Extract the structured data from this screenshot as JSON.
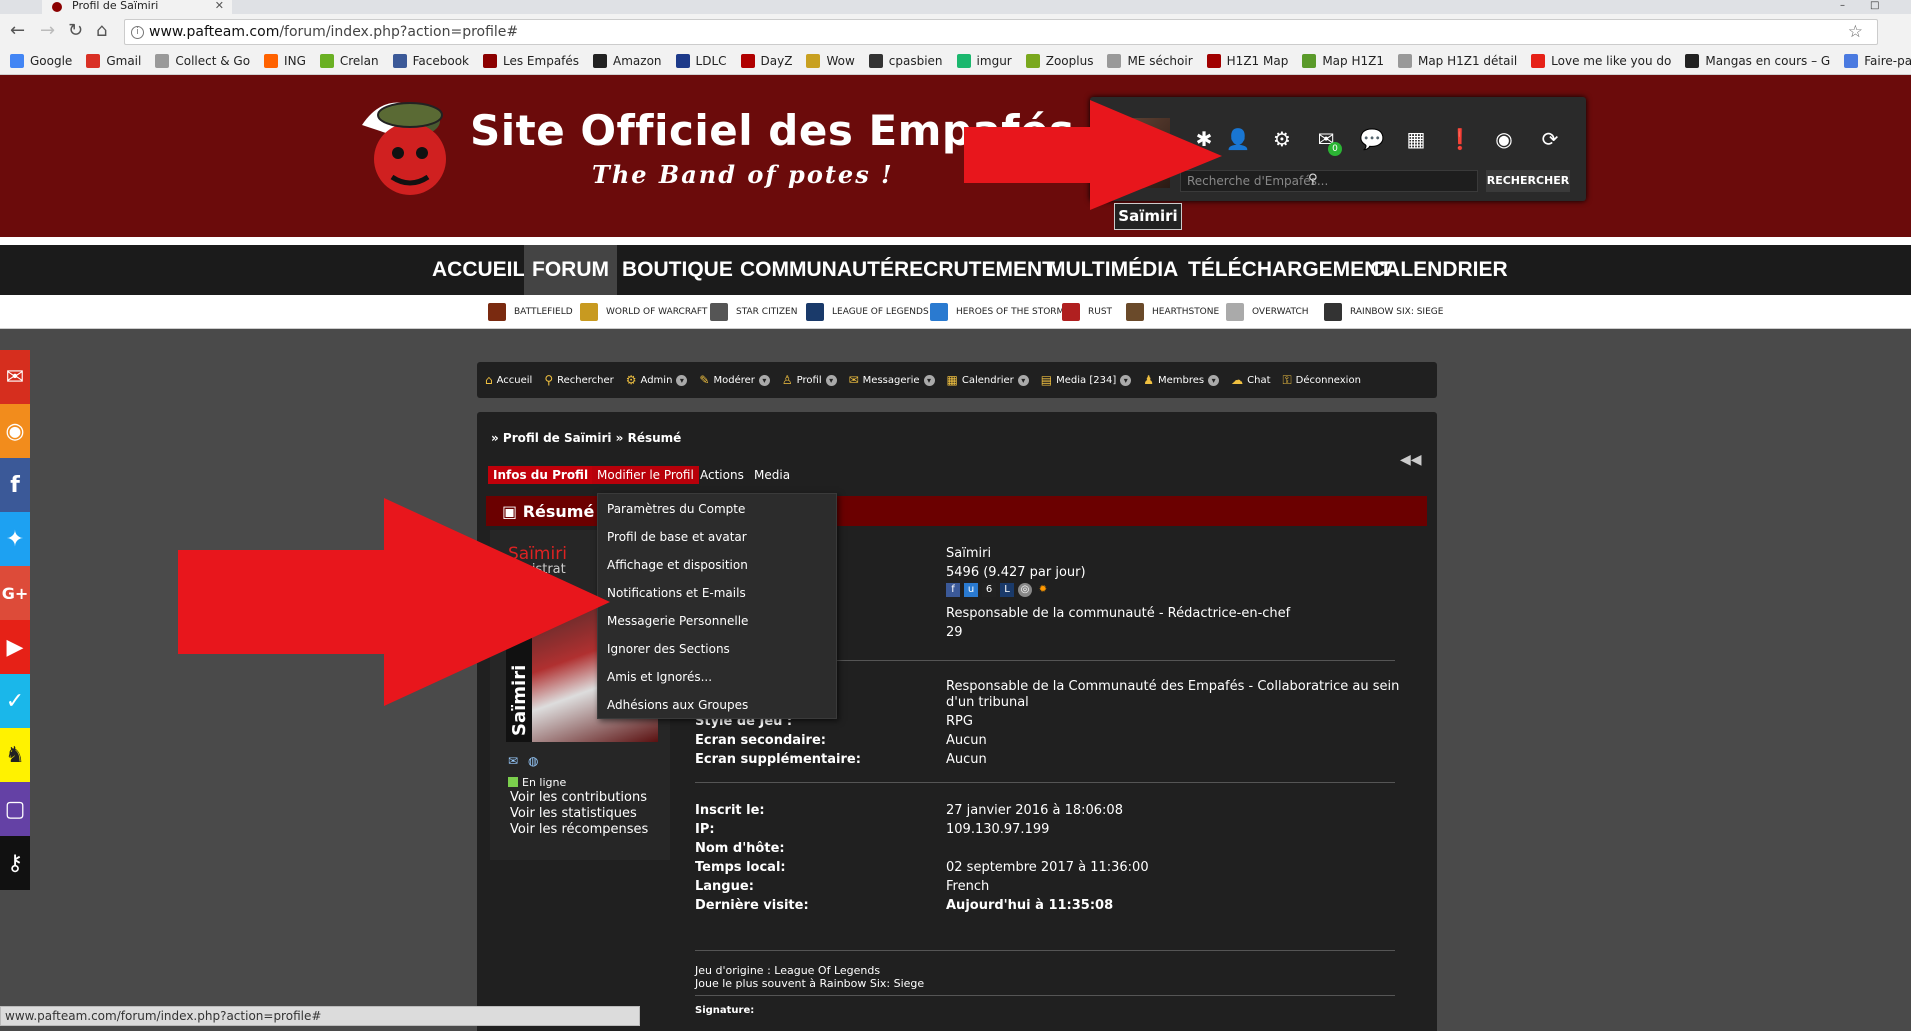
{
  "browser": {
    "tab_title": "Profil de Saïmiri",
    "url_host": "www.pafteam.com",
    "url_path": "/forum/index.php?action=profile#",
    "status_url": "www.pafteam.com/forum/index.php?action=profile#",
    "bookmarks": [
      {
        "label": "Google",
        "color": "#4285f4"
      },
      {
        "label": "Gmail",
        "color": "#d93025"
      },
      {
        "label": "Collect & Go",
        "color": "#999999"
      },
      {
        "label": "ING",
        "color": "#ff6200"
      },
      {
        "label": "Crelan",
        "color": "#6ab023"
      },
      {
        "label": "Facebook",
        "color": "#3b5998"
      },
      {
        "label": "Les Empafés",
        "color": "#8b0000"
      },
      {
        "label": "Amazon",
        "color": "#222222"
      },
      {
        "label": "LDLC",
        "color": "#1d3a8a"
      },
      {
        "label": "DayZ",
        "color": "#b00000"
      },
      {
        "label": "Wow",
        "color": "#c8a020"
      },
      {
        "label": "cpasbien",
        "color": "#333333"
      },
      {
        "label": "imgur",
        "color": "#1bb76e"
      },
      {
        "label": "Zooplus",
        "color": "#7aa81e"
      },
      {
        "label": "ME séchoir",
        "color": "#999999"
      },
      {
        "label": "H1Z1 Map",
        "color": "#a00000"
      },
      {
        "label": "Map H1Z1",
        "color": "#5a9a2a"
      },
      {
        "label": "Map H1Z1 détail",
        "color": "#999999"
      },
      {
        "label": "Love me like you do",
        "color": "#e62117"
      },
      {
        "label": "Mangas en cours – G",
        "color": "#222222"
      },
      {
        "label": "Faire-part Ben",
        "color": "#4a7ae0"
      }
    ]
  },
  "site": {
    "title": "Site Officiel des Empafés",
    "subtitle": "The Band of potes !",
    "search_placeholder": "Recherche d'Empafés...",
    "search_button": "RECHERCHER",
    "username": "Saïmiri",
    "message_badge": "0"
  },
  "main_nav": [
    {
      "label": "ACCUEIL"
    },
    {
      "label": "FORUM",
      "active": true
    },
    {
      "label": "BOUTIQUE"
    },
    {
      "label": "COMMUNAUTÉ"
    },
    {
      "label": "RECRUTEMENT"
    },
    {
      "label": "MULTIMÉDIA"
    },
    {
      "label": "TÉLÉCHARGEMENT"
    },
    {
      "label": "CALENDRIER"
    }
  ],
  "games": [
    {
      "label": "BATTLEFIELD",
      "color": "#7a2a10"
    },
    {
      "label": "WORLD OF WARCRAFT",
      "color": "#c89a20"
    },
    {
      "label": "STAR CITIZEN",
      "color": "#555555"
    },
    {
      "label": "LEAGUE OF LEGENDS",
      "color": "#1a3a6a"
    },
    {
      "label": "HEROES OF THE STORM",
      "color": "#2a7ad0"
    },
    {
      "label": "RUST",
      "color": "#b02020"
    },
    {
      "label": "HEARTHSTONE",
      "color": "#6a4a2a"
    },
    {
      "label": "OVERWATCH",
      "color": "#aaaaaa"
    },
    {
      "label": "RAINBOW SIX: SIEGE",
      "color": "#333333"
    }
  ],
  "social_colors": [
    "#d62e1e",
    "#f28c1c",
    "#3b5998",
    "#1da1f2",
    "#dd4b39",
    "#e62117",
    "#1ab7ea",
    "#fff200",
    "#6441a5",
    "#111111"
  ],
  "forum_nav": [
    {
      "label": "Accueil",
      "caret": false
    },
    {
      "label": "Rechercher",
      "caret": false
    },
    {
      "label": "Admin",
      "caret": true
    },
    {
      "label": "Modérer",
      "caret": true
    },
    {
      "label": "Profil",
      "caret": true
    },
    {
      "label": "Messagerie",
      "caret": true
    },
    {
      "label": "Calendrier",
      "caret": true
    },
    {
      "label": "Media [234]",
      "caret": true
    },
    {
      "label": "Membres",
      "caret": true
    },
    {
      "label": "Chat",
      "caret": false
    },
    {
      "label": "Déconnexion",
      "caret": false
    }
  ],
  "profile": {
    "breadcrumb": "» Profil de Saïmiri » Résumé",
    "tabs": [
      "Infos du Profil",
      "Modifier le Profil",
      "Actions",
      "Media"
    ],
    "summary_title": "Résumé",
    "name": "Saïmiri",
    "role": "inistrat",
    "avatar_text": "Saïmiri",
    "online": "En ligne",
    "side_links": [
      "Voir les contributions",
      "Voir les statistiques",
      "Voir les récompenses"
    ],
    "values_top": [
      "Saïmiri",
      "5496 (9.427 par jour)",
      "Responsable de la communauté - Rédactrice-en-chef",
      "29"
    ],
    "position_line1": "Responsable de la Communauté des Empafés - Collaboratrice au sein",
    "position_line2": "d'un tribunal",
    "style_label": "Style de Jeu :",
    "style_val": "RPG",
    "screen2_label": "Ecran secondaire:",
    "screen2_val": "Aucun",
    "screen3_label": "Ecran supplémentaire:",
    "screen3_val": "Aucun",
    "fields": [
      {
        "label": "Inscrit le:",
        "value": "27 janvier 2016 à 18:06:08"
      },
      {
        "label": "IP:",
        "value": "109.130.97.199"
      },
      {
        "label": "Nom d'hôte:",
        "value": ""
      },
      {
        "label": "Temps local:",
        "value": "02 septembre 2017 à 11:36:00"
      },
      {
        "label": "Langue:",
        "value": "French"
      },
      {
        "label": "Dernière visite:",
        "value": "Aujourd'hui à 11:35:08"
      }
    ],
    "origin_game": "Jeu d'origine : League Of Legends",
    "most_played": "Joue le plus souvent à Rainbow Six: Siege",
    "signature_label": "Signature:"
  },
  "dropdown": [
    "Paramètres du Compte",
    "Profil de base et avatar",
    "Affichage et disposition",
    "Notifications et E-mails",
    "Messagerie Personnelle",
    "Ignorer des Sections",
    "Amis et Ignorés...",
    "Adhésions aux Groupes"
  ],
  "arrow_color": "#e8161c"
}
